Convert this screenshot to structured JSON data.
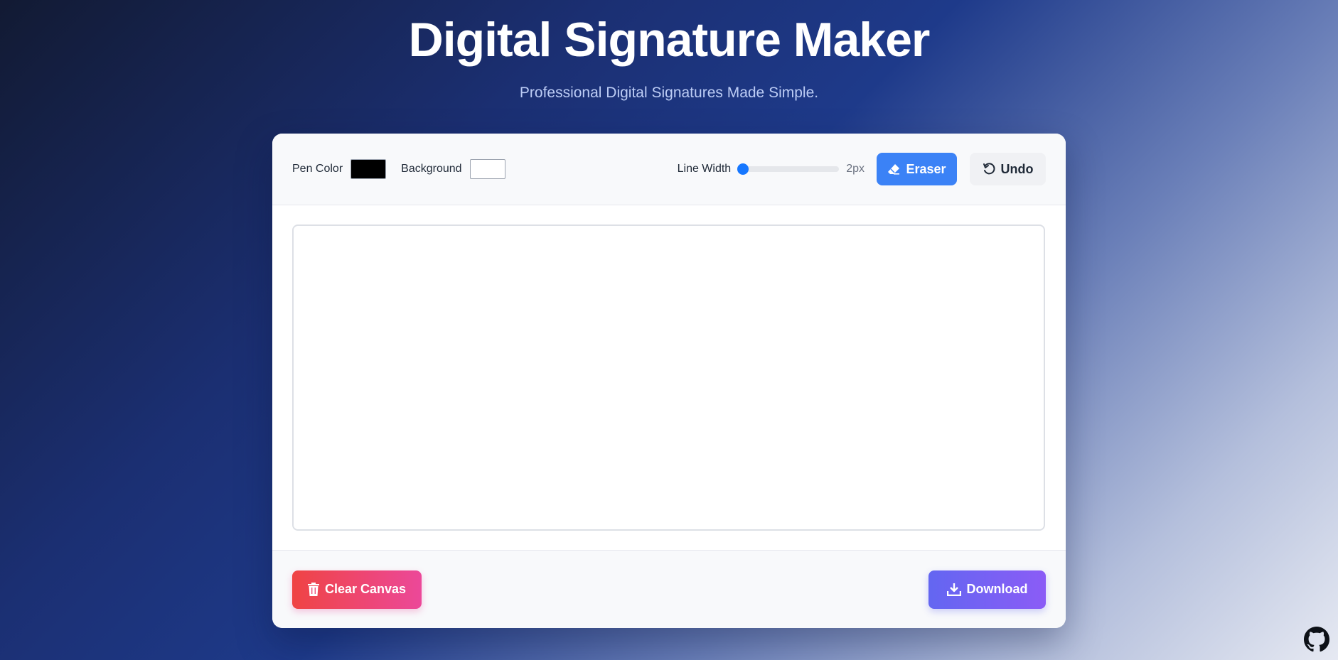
{
  "header": {
    "title": "Digital Signature Maker",
    "subtitle": "Professional Digital Signatures Made Simple."
  },
  "toolbar": {
    "pen_color_label": "Pen Color",
    "pen_color": "#000000",
    "background_label": "Background",
    "background_color": "#ffffff",
    "line_width_label": "Line Width",
    "line_width_value": "2px",
    "line_width_fraction": 0.0,
    "eraser_label": "Eraser",
    "undo_label": "Undo"
  },
  "footer": {
    "clear_label": "Clear Canvas",
    "download_label": "Download"
  },
  "icons": {
    "eraser": "eraser-icon",
    "undo": "undo-icon",
    "trash": "trash-icon",
    "download": "download-icon",
    "github": "github-icon"
  },
  "colors": {
    "accent": "#3b82f6",
    "slider": "#1677ff",
    "clear_start": "#ef4444",
    "clear_end": "#ec4899",
    "download_start": "#6366f1",
    "download_end": "#8b5cf6"
  }
}
